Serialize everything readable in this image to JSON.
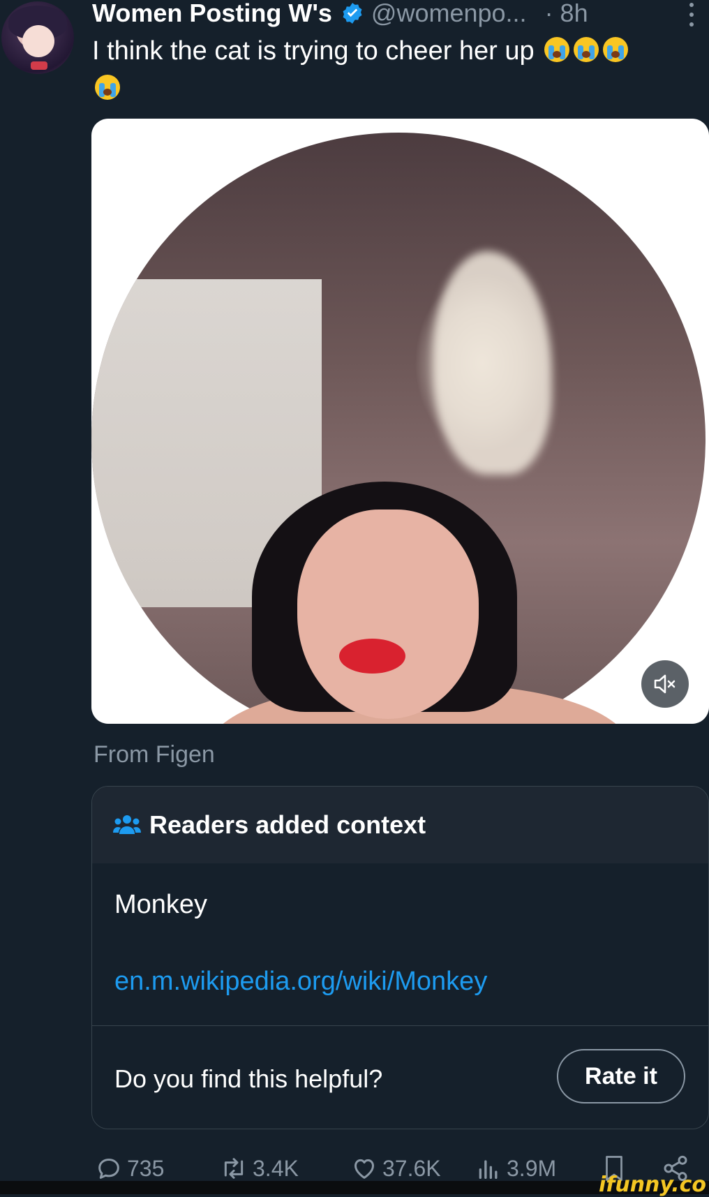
{
  "tweet": {
    "author_name": "Women Posting W's",
    "handle": "@womenpo...",
    "time": "· 8h",
    "text": "I think the cat is trying to cheer her up",
    "emojis": [
      "loudly-crying-face",
      "loudly-crying-face",
      "loudly-crying-face",
      "loudly-crying-face"
    ],
    "media_source": "From Figen"
  },
  "community_note": {
    "title": "Readers added context",
    "body": "Monkey",
    "link": "en.m.wikipedia.org/wiki/Monkey",
    "helpful_prompt": "Do you find this helpful?",
    "rate_label": "Rate it"
  },
  "actions": {
    "replies": "735",
    "reposts": "3.4K",
    "likes": "37.6K",
    "views": "3.9M"
  },
  "watermark": "ifunny.co",
  "colors": {
    "background": "#15202b",
    "accent": "#1d9bf0",
    "muted": "#8b98a5"
  }
}
